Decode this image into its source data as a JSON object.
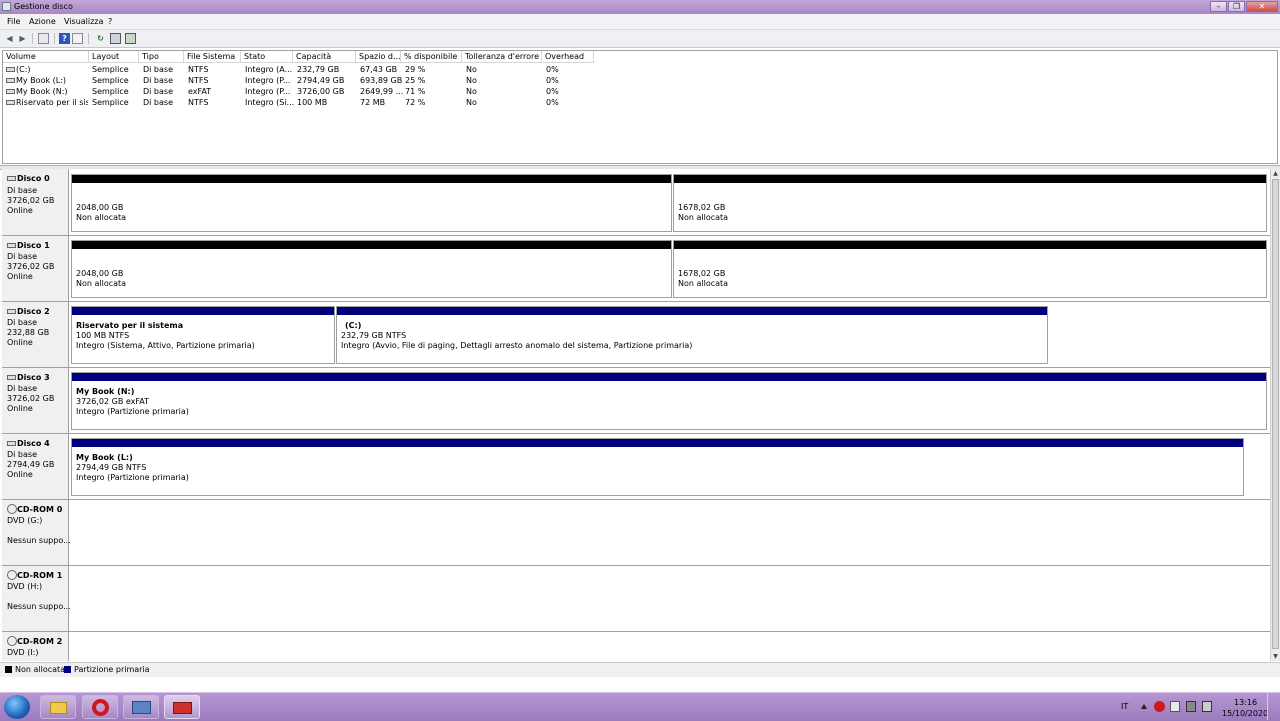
{
  "window": {
    "title": "Gestione disco",
    "min_glyph": "–",
    "max_glyph": "❐",
    "close_glyph": "✕"
  },
  "menu": [
    "File",
    "Azione",
    "Visualizza",
    "?"
  ],
  "toolbar_glyphs": {
    "back": "◀",
    "forward": "▶",
    "help": "?",
    "refresh": "↻"
  },
  "volume_list": {
    "columns": [
      "Volume",
      "Layout",
      "Tipo",
      "File Sistema",
      "Stato",
      "Capacità",
      "Spazio d...",
      "% disponibile",
      "Tolleranza d'errore",
      "Overhead"
    ],
    "rows": [
      [
        "(C:)",
        "Semplice",
        "Di base",
        "NTFS",
        "Integro (A...",
        "232,79 GB",
        "67,43 GB",
        "29 %",
        "No",
        "0%"
      ],
      [
        "My Book (L:)",
        "Semplice",
        "Di base",
        "NTFS",
        "Integro (P...",
        "2794,49 GB",
        "693,89 GB",
        "25 %",
        "No",
        "0%"
      ],
      [
        "My Book (N:)",
        "Semplice",
        "Di base",
        "exFAT",
        "Integro (P...",
        "3726,00 GB",
        "2649,99 ...",
        "71 %",
        "No",
        "0%"
      ],
      [
        "Riservato per il sist...",
        "Semplice",
        "Di base",
        "NTFS",
        "Integro (Si...",
        "100 MB",
        "72 MB",
        "72 %",
        "No",
        "0%"
      ]
    ]
  },
  "disks": [
    {
      "name": "Disco 0",
      "type": "Di base",
      "size": "3726,02 GB",
      "status": "Online",
      "partitions": [
        {
          "kind": "unallocated",
          "line1": "",
          "line2": "2048,00 GB",
          "line3": "Non allocata"
        },
        {
          "kind": "unallocated",
          "line1": "",
          "line2": "1678,02 GB",
          "line3": "Non allocata"
        }
      ]
    },
    {
      "name": "Disco 1",
      "type": "Di base",
      "size": "3726,02 GB",
      "status": "Online",
      "partitions": [
        {
          "kind": "unallocated",
          "line1": "",
          "line2": "2048,00 GB",
          "line3": "Non allocata"
        },
        {
          "kind": "unallocated",
          "line1": "",
          "line2": "1678,02 GB",
          "line3": "Non allocata"
        }
      ]
    },
    {
      "name": "Disco 2",
      "type": "Di base",
      "size": "232,88 GB",
      "status": "Online",
      "partitions": [
        {
          "kind": "primary",
          "line1": "Riservato per il sistema",
          "line2": "100 MB NTFS",
          "line3": "Integro (Sistema, Attivo, Partizione primaria)"
        },
        {
          "kind": "primary",
          "line1": "(C:)",
          "line2": "232,79 GB NTFS",
          "line3": "Integro (Avvio, File di paging, Dettagli arresto anomalo del sistema, Partizione primaria)"
        }
      ]
    },
    {
      "name": "Disco 3",
      "type": "Di base",
      "size": "3726,02 GB",
      "status": "Online",
      "partitions": [
        {
          "kind": "primary",
          "line1": "My Book  (N:)",
          "line2": "3726,02 GB exFAT",
          "line3": "Integro (Partizione primaria)"
        }
      ]
    },
    {
      "name": "Disco 4",
      "type": "Di base",
      "size": "2794,49 GB",
      "status": "Online",
      "partitions": [
        {
          "kind": "primary",
          "line1": "My Book  (L:)",
          "line2": "2794,49 GB NTFS",
          "line3": "Integro (Partizione primaria)"
        }
      ]
    }
  ],
  "cdroms": [
    {
      "name": "CD-ROM 0",
      "drive": "DVD (G:)",
      "status": "Nessun suppo..."
    },
    {
      "name": "CD-ROM 1",
      "drive": "DVD (H:)",
      "status": "Nessun suppo..."
    },
    {
      "name": "CD-ROM 2",
      "drive": "DVD (I:)",
      "status": ""
    }
  ],
  "legend": [
    {
      "label": "Non allocata",
      "color": "#000000"
    },
    {
      "label": "Partizione primaria",
      "color": "#00007f"
    }
  ],
  "colors": {
    "unallocated": "#000000",
    "primary": "#00007f",
    "accent": "#a987c6"
  },
  "taskbar": {
    "apps": [
      "explorer-icon",
      "opera-icon",
      "computer-management-icon",
      "disk-management-icon"
    ],
    "language": "IT",
    "time": "13:16",
    "date": "15/10/2020"
  }
}
